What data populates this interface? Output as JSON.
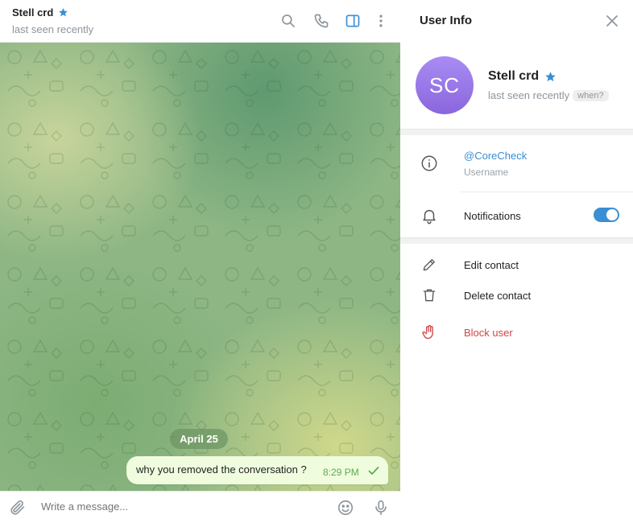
{
  "chat": {
    "title": "Stell crd",
    "status": "last seen recently",
    "date_separator": "April 25",
    "message": {
      "text": "why you removed the conversation ?",
      "time": "8:29 PM",
      "status_icon": "check-icon"
    },
    "composer_placeholder": "Write a message..."
  },
  "header_icons": [
    "search-icon",
    "phone-icon",
    "sidebar-toggle-icon",
    "more-vertical-icon"
  ],
  "composer_icons": [
    "attach-icon",
    "emoji-icon",
    "microphone-icon"
  ],
  "user_info": {
    "panel_title": "User Info",
    "avatar_initials": "SC",
    "name": "Stell crd",
    "status": "last seen recently",
    "when_label": "when?",
    "username": "@CoreCheck",
    "username_caption": "Username",
    "notifications_label": "Notifications",
    "notifications_enabled": true,
    "edit_label": "Edit contact",
    "delete_label": "Delete contact",
    "block_label": "Block user"
  },
  "colors": {
    "accent": "#3a8fd4",
    "danger": "#d14545",
    "bubble": "#effdde",
    "avatar": "#9574e8",
    "star": "#3a8fd4"
  }
}
